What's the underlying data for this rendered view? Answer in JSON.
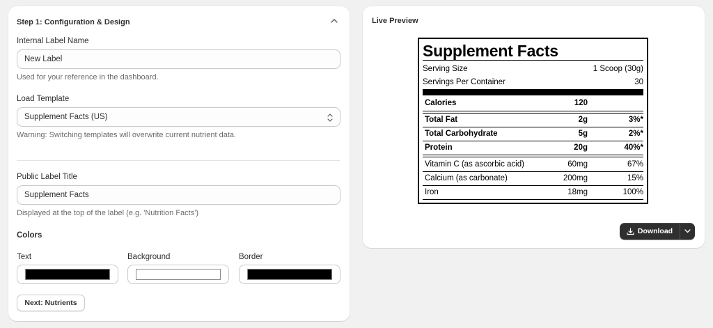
{
  "config": {
    "title": "Step 1: Configuration & Design",
    "internal_label": {
      "label": "Internal Label Name",
      "value": "New Label",
      "help": "Used for your reference in the dashboard."
    },
    "template": {
      "label": "Load Template",
      "selected": "Supplement Facts (US)",
      "warning": "Warning: Switching templates will overwrite current nutrient data."
    },
    "public_title": {
      "label": "Public Label Title",
      "value": "Supplement Facts",
      "help": "Displayed at the top of the label (e.g. 'Nutrition Facts')"
    },
    "colors": {
      "heading": "Colors",
      "text_label": "Text",
      "background_label": "Background",
      "border_label": "Border",
      "text_color": "#000000",
      "background_color": "#ffffff",
      "border_color": "#000000"
    },
    "next_button": "Next: Nutrients"
  },
  "preview": {
    "title": "Live Preview",
    "download_button": "Download",
    "label": {
      "title": "Supplement Facts",
      "serving_size_label": "Serving Size",
      "serving_size_value": "1 Scoop (30g)",
      "servings_per_container_label": "Servings Per Container",
      "servings_per_container_value": "30",
      "calories": {
        "name": "Calories",
        "amount": "120"
      },
      "macros": [
        {
          "name": "Total Fat",
          "amount": "2g",
          "dv": "3%*"
        },
        {
          "name": "Total Carbohydrate",
          "amount": "5g",
          "dv": "2%*"
        },
        {
          "name": "Protein",
          "amount": "20g",
          "dv": "40%*"
        }
      ],
      "micros": [
        {
          "name": "Vitamin C (as ascorbic acid)",
          "amount": "60mg",
          "dv": "67%"
        },
        {
          "name": "Calcium (as carbonate)",
          "amount": "200mg",
          "dv": "15%"
        },
        {
          "name": "Iron",
          "amount": "18mg",
          "dv": "100%"
        }
      ]
    }
  },
  "icons": {
    "collapse": "chevron-up-icon",
    "select": "select-arrows-icon",
    "download": "download-icon",
    "split": "chevron-down-icon"
  },
  "theme": {
    "page_background": "#f1f1f1",
    "primary_button": "#2f2f2f"
  }
}
